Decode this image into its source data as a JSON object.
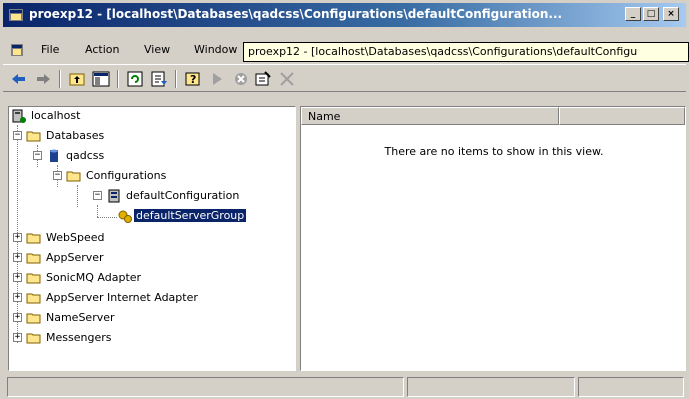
{
  "window": {
    "title": "proexp12 - [localhost\\Databases\\qadcss\\Configurations\\defaultConfiguration...",
    "tooltip": "proexp12 - [localhost\\Databases\\qadcss\\Configurations\\defaultConfigu",
    "caption_buttons": {
      "minimize": "_",
      "maximize": "□",
      "close": "×"
    }
  },
  "menu": {
    "items": [
      "File",
      "Action",
      "View",
      "Window"
    ]
  },
  "toolbar": {
    "buttons": [
      "back-arrow-icon",
      "forward-arrow-icon",
      "up-folder-icon",
      "show-hide-tree-icon",
      "refresh-icon",
      "export-list-icon",
      "help-icon",
      "start-icon",
      "stop-icon",
      "properties-icon",
      "delete-icon"
    ]
  },
  "tree": {
    "root": "localhost",
    "databases": "Databases",
    "qadcss": "qadcss",
    "configurations": "Configurations",
    "default_configuration": "defaultConfiguration",
    "default_server_group": "defaultServerGroup",
    "top_items": [
      "WebSpeed",
      "AppServer",
      "SonicMQ Adapter",
      "AppServer Internet Adapter",
      "NameServer",
      "Messengers"
    ]
  },
  "list": {
    "column_name": "Name",
    "empty_message": "There are no items to show in this view."
  },
  "colors": {
    "title_active": "#0a246a",
    "selection": "#0a246a",
    "folder": "#ffe68c",
    "tooltip_bg": "#ffffe1"
  }
}
